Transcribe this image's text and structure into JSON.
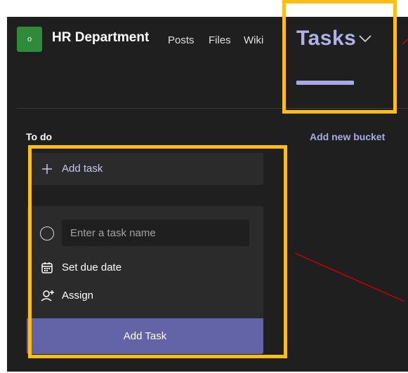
{
  "header": {
    "team_initial": "o",
    "team_name": "HR Department",
    "tabs": [
      "Posts",
      "Files",
      "Wiki"
    ],
    "active_tab": "Tasks"
  },
  "board": {
    "bucket_title": "To do",
    "add_bucket_label": "Add new bucket",
    "add_task_label": "Add task"
  },
  "task_form": {
    "input_placeholder": "Enter a task name",
    "input_value": "",
    "due_date_label": "Set due date",
    "assign_label": "Assign",
    "submit_label": "Add Task"
  },
  "colors": {
    "background": "#1f1f1f",
    "surface": "#2b2b2b",
    "accent": "#6264a7",
    "accent_text": "#a9abe6",
    "avatar": "#2e8b3a",
    "highlight": "#fbbd16",
    "annotation_line": "#cc0000"
  },
  "icons": [
    "chevron-down-icon",
    "plus-icon",
    "checkbox-circle-icon",
    "calendar-icon",
    "assign-person-icon"
  ]
}
